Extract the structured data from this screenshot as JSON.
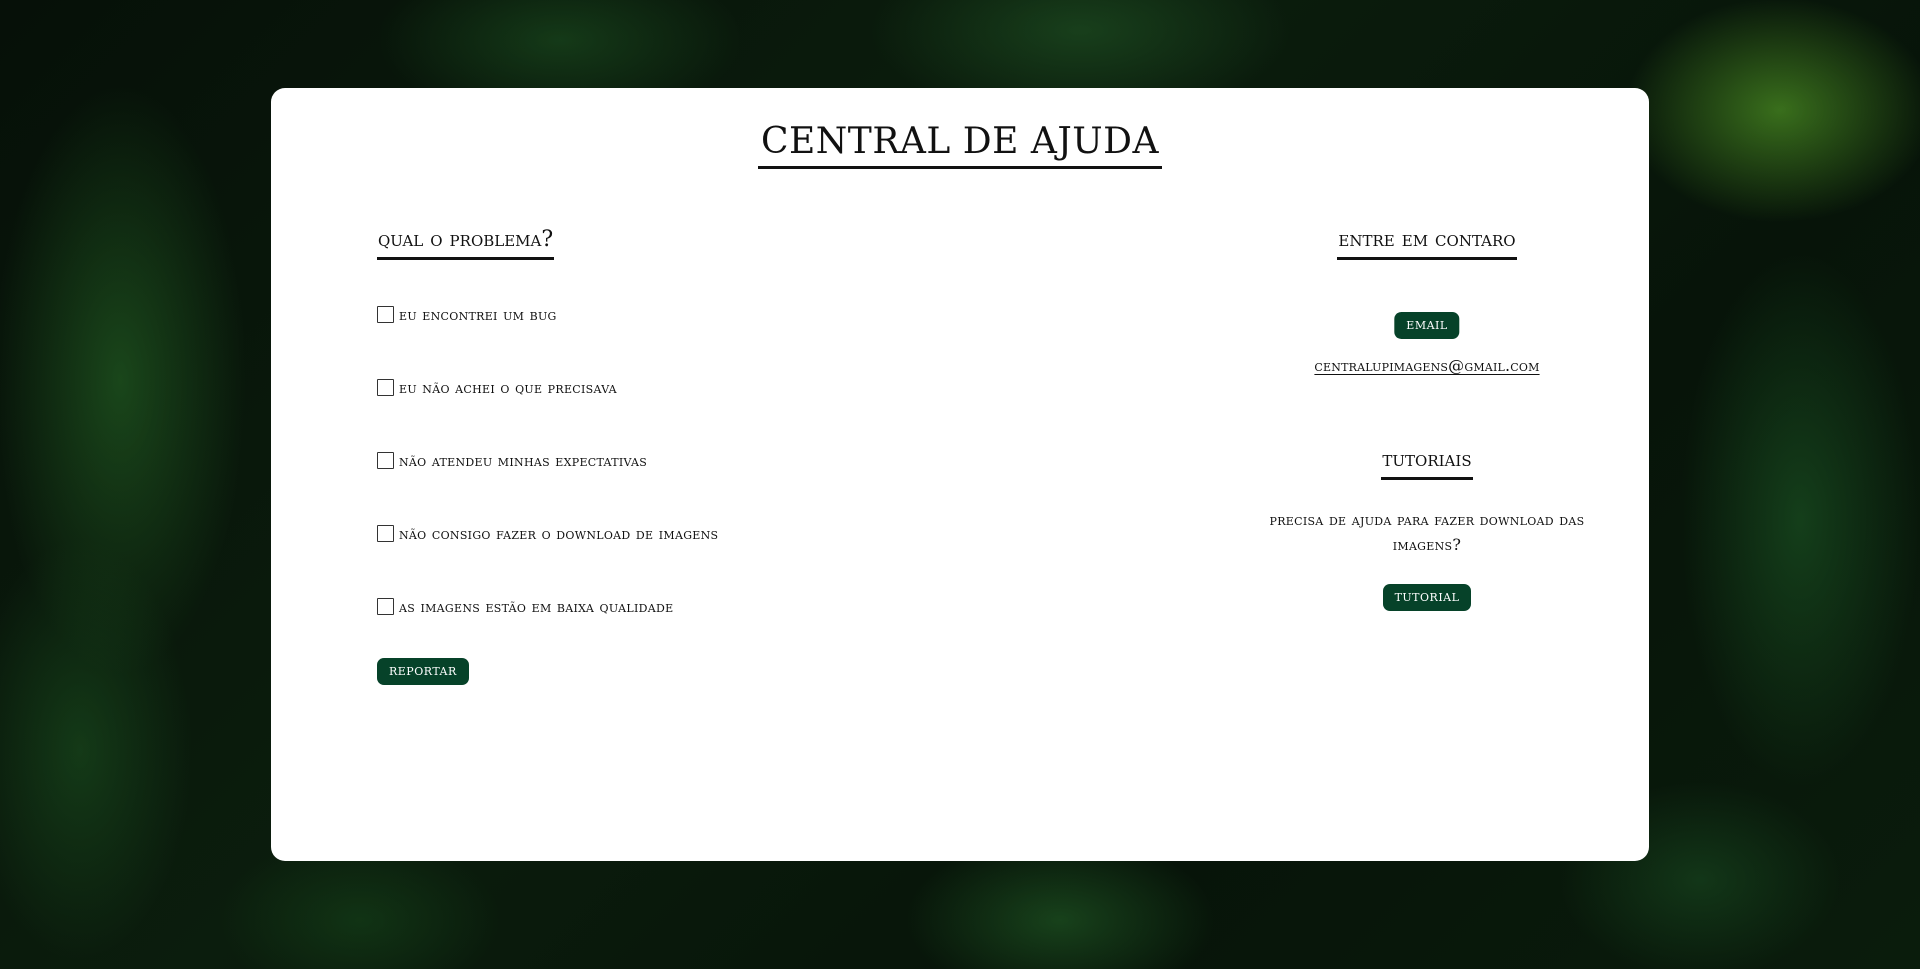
{
  "page": {
    "title": "CENTRAL DE AJUDA"
  },
  "problems": {
    "heading": "QUAL O PROBLEMA?",
    "items": [
      {
        "label": "EU ENCONTREI UM BUG",
        "checked": false
      },
      {
        "label": "EU NÃO ACHEI O QUE PRECISAVA",
        "checked": false
      },
      {
        "label": "NÃO ATENDEU MINHAS EXPECTATIVAS",
        "checked": false
      },
      {
        "label": "NÃO CONSIGO FAZER O DOWNLOAD DE IMAGENS",
        "checked": false
      },
      {
        "label": "AS IMAGENS ESTÃO EM BAIXA QUALIDADE",
        "checked": false
      }
    ],
    "report_button": "REPORTAR"
  },
  "contact": {
    "heading": "ENTRE EM CONTARO",
    "email_button": "EMAIL",
    "email_address": "centralupimagens@gmail.com"
  },
  "tutorials": {
    "heading": "TUTORIAIS",
    "text": "PRECISA DE AJUDA PARA FAZER DOWNLOAD DAS IMAGENS?",
    "tutorial_button": "TUTORIAL"
  },
  "colors": {
    "button_bg": "#064229",
    "card_bg": "#ffffff",
    "text": "#111111"
  }
}
